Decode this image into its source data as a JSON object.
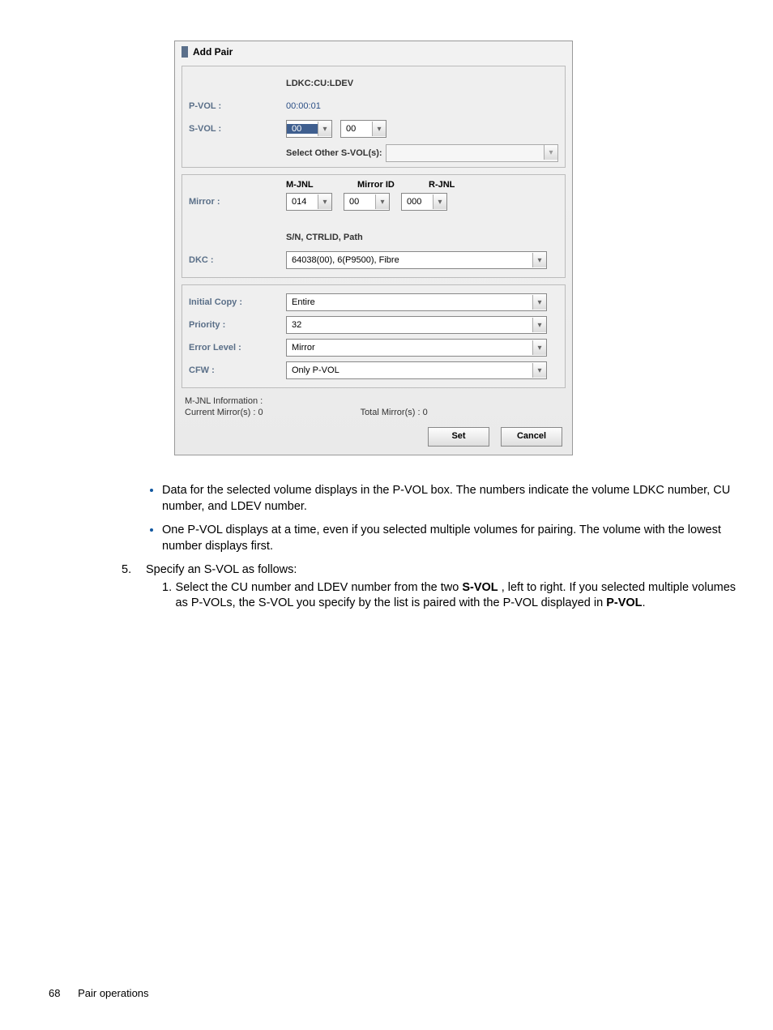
{
  "dialog": {
    "title": "Add Pair",
    "col_header": "LDKC:CU:LDEV",
    "pvol_label": "P-VOL :",
    "pvol_value": "00:00:01",
    "svol_label": "S-VOL :",
    "svol_sel1": "00",
    "svol_sel2": "00",
    "select_other_label": "Select Other S-VOL(s):",
    "mjnl_hdr": "M-JNL",
    "mirrorid_hdr": "Mirror ID",
    "rjnl_hdr": "R-JNL",
    "mirror_label": "Mirror :",
    "mirror_v1": "014",
    "mirror_v2": "00",
    "mirror_v3": "000",
    "sn_header": "S/N, CTRLID, Path",
    "dkc_label": "DKC :",
    "dkc_value": "64038(00), 6(P9500), Fibre",
    "initial_copy_label": "Initial Copy :",
    "initial_copy_value": "Entire",
    "priority_label": "Priority :",
    "priority_value": "32",
    "error_level_label": "Error Level :",
    "error_level_value": "Mirror",
    "cfw_label": "CFW :",
    "cfw_value": "Only P-VOL",
    "mjnl_info_label": "M-JNL Information :",
    "current_mirrors": "Current Mirror(s) :  0",
    "total_mirrors": "Total Mirror(s) :  0",
    "set_btn": "Set",
    "cancel_btn": "Cancel"
  },
  "doc": {
    "bullet1": "Data for the selected volume displays in the P-VOL box. The numbers indicate the volume LDKC number, CU number, and LDEV number.",
    "bullet2": "One P-VOL displays at a time, even if you selected multiple volumes for pairing. The volume with the lowest number displays first.",
    "step5_num": "5.",
    "step5_text": "Specify an S-VOL as follows:",
    "sub1_num": "1.",
    "sub1_a": "Select the CU number and LDEV number from the two ",
    "sub1_bold1": "S-VOL",
    "sub1_b": " , left to right. If you selected multiple volumes as P-VOLs, the S-VOL you specify by the list is paired with the P-VOL displayed in ",
    "sub1_bold2": "P-VOL",
    "sub1_c": "."
  },
  "footer": {
    "page_num": "68",
    "section": "Pair operations"
  }
}
